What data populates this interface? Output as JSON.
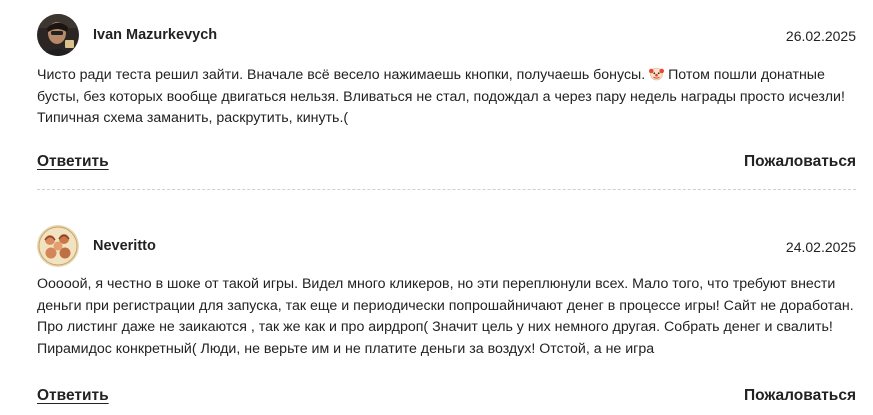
{
  "comments": [
    {
      "author": "Ivan Mazurkevych",
      "date": "26.02.2025",
      "text_before_emoji": "Чисто ради теста решил зайти. Вначале всё весело нажимаешь кнопки, получаешь бонусы. ",
      "emoji": "clown-face-emoji",
      "text_after_emoji": " Потом пошли донатные бусты, без которых вообще двигаться нельзя. Вливаться не стал, подождал а через пару недель награды просто исчезли! Типичная схема заманить, раскрутить, кинуть.(",
      "reply_label": "Ответить",
      "report_label": "Пожаловаться"
    },
    {
      "author": "Neveritto",
      "date": "24.02.2025",
      "text": "Ооооой, я честно в шоке от такой игры. Видел много кликеров, но эти переплюнули всех. Мало того, что требуют внести деньги при регистрации для запуска, так еще и периодически попрошайничают денег в процессе игры! Сайт не доработан. Про листинг даже не заикаются , так же как и про аирдроп( Значит цель у них немного другая. Собрать денег и свалить! Пирамидос конкретный( Люди, не верьте им и не платите деньги за воздух! Отстой, а не игра",
      "reply_label": "Ответить",
      "report_label": "Пожаловаться"
    }
  ],
  "colors": {
    "text": "#222222",
    "divider": "#cfcfcf"
  }
}
